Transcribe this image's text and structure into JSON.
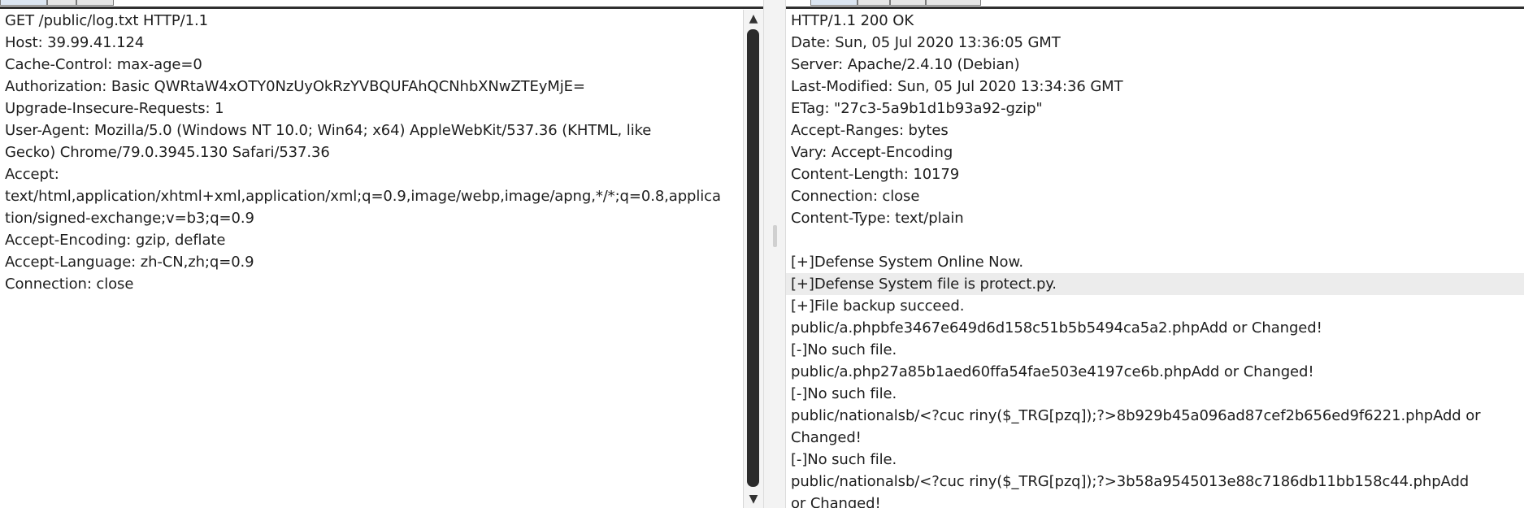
{
  "request": {
    "lines": [
      "GET /public/log.txt HTTP/1.1",
      "Host: 39.99.41.124",
      "Cache-Control: max-age=0",
      "Authorization: Basic QWRtaW4xOTY0NzUyOkRzYVBQUFAhQCNhbXNwZTEyMjE=",
      "Upgrade-Insecure-Requests: 1",
      "User-Agent: Mozilla/5.0 (Windows NT 10.0; Win64; x64) AppleWebKit/537.36 (KHTML, like",
      "Gecko) Chrome/79.0.3945.130 Safari/537.36",
      "Accept:",
      "text/html,application/xhtml+xml,application/xml;q=0.9,image/webp,image/apng,*/*;q=0.8,applica",
      "tion/signed-exchange;v=b3;q=0.9",
      "Accept-Encoding: gzip, deflate",
      "Accept-Language: zh-CN,zh;q=0.9",
      "Connection: close"
    ]
  },
  "response": {
    "lines": [
      "HTTP/1.1 200 OK",
      "Date: Sun, 05 Jul 2020 13:36:05 GMT",
      "Server: Apache/2.4.10 (Debian)",
      "Last-Modified: Sun, 05 Jul 2020 13:34:36 GMT",
      "ETag: \"27c3-5a9b1d1b93a92-gzip\"",
      "Accept-Ranges: bytes",
      "Vary: Accept-Encoding",
      "Content-Length: 10179",
      "Connection: close",
      "Content-Type: text/plain",
      "",
      "[+]Defense System Online Now.",
      "[+]Defense System file is protect.py.",
      "[+]File backup succeed.",
      "public/a.phpbfe3467e649d6d158c51b5b5494ca5a2.phpAdd or Changed!",
      "[-]No such file.",
      "public/a.php27a85b1aed60ffa54fae503e4197ce6b.phpAdd or Changed!",
      "[-]No such file.",
      "public/nationalsb/<?cuc riny($_TRG[pzq]);?>8b929b45a096ad87cef2b656ed9f6221.phpAdd or",
      "Changed!",
      "[-]No such file.",
      "public/nationalsb/<?cuc riny($_TRG[pzq]);?>3b58a9545013e88c7186db11bb158c44.phpAdd",
      "or Changed!"
    ],
    "highlighted_line": 12
  },
  "scrollbar": {
    "up_icon": "▲",
    "down_icon": "▼"
  }
}
